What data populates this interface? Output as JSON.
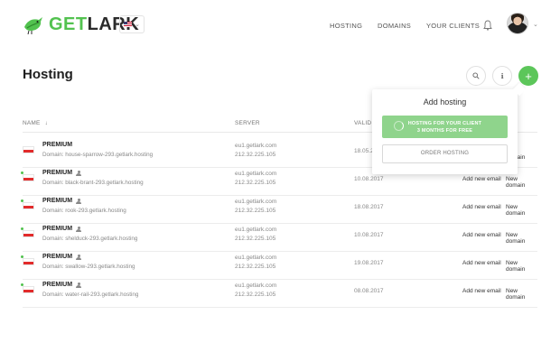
{
  "header": {
    "logo": {
      "part1": "GET",
      "part2": "LARK"
    },
    "language": {
      "flag": "us-flag",
      "chevron": "chevron-down-icon"
    },
    "nav": [
      {
        "label": "HOSTING"
      },
      {
        "label": "DOMAINS"
      },
      {
        "label": "YOUR CLIENTS"
      }
    ],
    "icons": {
      "notifications": "bell-icon",
      "avatar": "avatar",
      "menu": "chevron-down-icon"
    }
  },
  "page": {
    "title": "Hosting",
    "actions": {
      "search": "search-icon",
      "info": "info-icon",
      "add": "+"
    }
  },
  "table": {
    "columns": {
      "name": "NAME",
      "server": "SERVER",
      "valid": "VALID U"
    },
    "sort_arrow": "↓",
    "rows": [
      {
        "plan": "PREMIUM",
        "domain": "Domain: house-sparrow-293.getlark.hosting",
        "server": "eu1.getlark.com",
        "ip": "212.32.225.105",
        "valid": "18.05.2",
        "add_email": "",
        "new_domain": "New domain",
        "user_icon": false,
        "active": false
      },
      {
        "plan": "PREMIUM",
        "domain": "Domain: black-brant-293.getlark.hosting",
        "server": "eu1.getlark.com",
        "ip": "212.32.225.105",
        "valid": "10.08.2017",
        "add_email": "Add new email",
        "new_domain": "New domain",
        "user_icon": true,
        "active": true
      },
      {
        "plan": "PREMIUM",
        "domain": "Domain: rook-293.getlark.hosting",
        "server": "eu1.getlark.com",
        "ip": "212.32.225.105",
        "valid": "18.08.2017",
        "add_email": "Add new email",
        "new_domain": "New domain",
        "user_icon": true,
        "active": true
      },
      {
        "plan": "PREMIUM",
        "domain": "Domain: shelduck-293.getlark.hosting",
        "server": "eu1.getlark.com",
        "ip": "212.32.225.105",
        "valid": "10.08.2017",
        "add_email": "Add new email",
        "new_domain": "New domain",
        "user_icon": true,
        "active": true
      },
      {
        "plan": "PREMIUM",
        "domain": "Domain: swallow-293.getlark.hosting",
        "server": "eu1.getlark.com",
        "ip": "212.32.225.105",
        "valid": "19.08.2017",
        "add_email": "Add new email",
        "new_domain": "New domain",
        "user_icon": true,
        "active": true
      },
      {
        "plan": "PREMIUM",
        "domain": "Domain: water-rail-293.getlark.hosting",
        "server": "eu1.getlark.com",
        "ip": "212.32.225.105",
        "valid": "08.08.2017",
        "add_email": "Add new email",
        "new_domain": "New domain",
        "user_icon": true,
        "active": true
      }
    ]
  },
  "popup": {
    "title": "Add hosting",
    "primary_line1": "HOSTING FOR YOUR CLIENT",
    "primary_line2": "3 MONTHS FOR FREE",
    "secondary": "ORDER HOSTING"
  },
  "colors": {
    "brand_green": "#52c24f",
    "popup_green": "#8fd48c",
    "flag_red": "#e22b2b"
  }
}
